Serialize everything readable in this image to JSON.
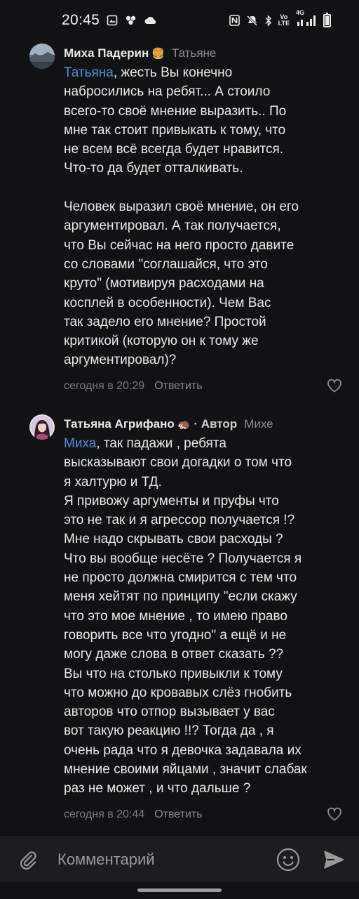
{
  "status_bar": {
    "time": "20:45",
    "network": "4G",
    "icons": [
      "gallery-icon",
      "flower-icon",
      "cloud-icon",
      "nfc-icon",
      "mute-icon",
      "bluetooth-icon",
      "volte-icon",
      "signal-icon",
      "battery-icon"
    ],
    "volte_label": "Vo\nLTE",
    "battery_level": 0.85
  },
  "comments": [
    {
      "author": "Миха Падерин",
      "author_emoji": "🍔",
      "reply_to": "Татьяне",
      "mention": "Татьяна",
      "text": ", жесть Вы конечно\nнабросились на ребят... А стоило\nвсего-то своё мнение выразить.. По\nмне так стоит привыкать к тому, что\nне всем всё всегда будет нравится.\nЧто-то да будет отталкивать.\n\nЧеловек выразил своё мнение, он его\nаргументировал. А так получается,\nчто Вы сейчас на него просто давите\nсо словами \"соглашайся, что это\nкруто\" (мотивируя расходами на\nкосплей в особенности). Чем Вас\nтак задело его мнение? Простой\nкритикой (которую он к тому же\nаргументировал)?",
      "timestamp": "сегодня в 20:29",
      "reply_label": "Ответить",
      "icons": [
        "avatar",
        "heart-icon"
      ]
    },
    {
      "author": "Татьяна Агрифано",
      "author_emoji": "🦔",
      "badge": "· Автор",
      "reply_to": "Михе",
      "mention": "Миха",
      "text": ", так падажи , ребята\nвысказывают свои догадки о том что\nя халтурю и ТД.\nЯ привожу аргументы и пруфы что\nэто не так и я агрессор получается !?\nМне надо скрывать свои расходы ?\nЧто вы вообще несёте ? Получается я\nне просто должна смирится с тем что\nменя хейтят по принципу \"если скажу\nчто это мое мнение , то имею право\nговорить все что угодно\" а ещё и не\nмогу даже слова в ответ сказать ??\nВы что на столько привыкли к тому\nчто можно до кровавых слёз гнобить\nавторов что отпор вызывает у вас\nвот такую реакцию !!? Тогда да , я\nочень рада что я девочка задавала их\nмнение своими яйцами , значит слабак\nраз не может , и что дальше ?",
      "timestamp": "сегодня в 20:44",
      "reply_label": "Ответить",
      "icons": [
        "avatar",
        "heart-icon"
      ]
    }
  ],
  "input_bar": {
    "placeholder": "Комментарий",
    "icons": [
      "paperclip-icon",
      "emoji-icon",
      "send-icon"
    ]
  },
  "colors": {
    "background": "#111213",
    "mention": "#4a8fe0",
    "meta": "#7d7d7d"
  }
}
